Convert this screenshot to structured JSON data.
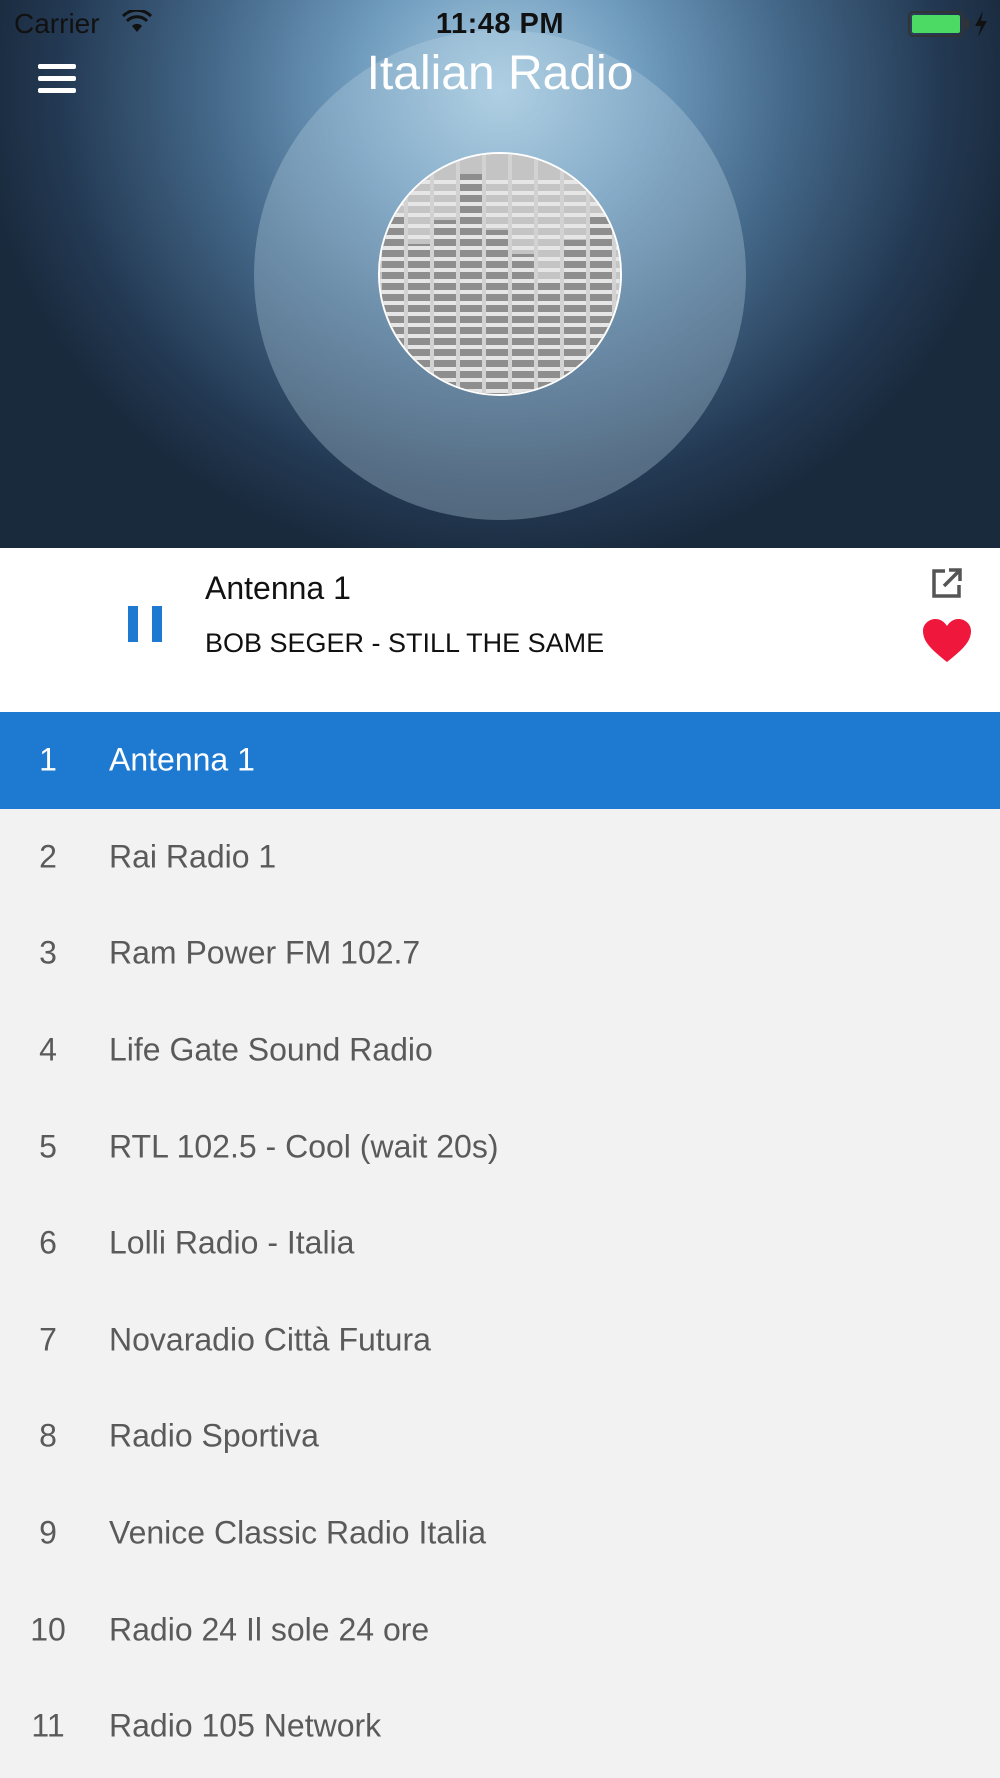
{
  "status_bar": {
    "carrier": "Carrier",
    "time": "11:48 PM",
    "icons": [
      "wifi-icon",
      "battery-icon",
      "charging-bolt-icon"
    ]
  },
  "header": {
    "title": "Italian Radio",
    "menu_icon": "hamburger-menu-icon"
  },
  "now_playing": {
    "station": "Antenna 1",
    "track": "BOB SEGER - STILL THE SAME",
    "state": "playing",
    "icons": [
      "pause-icon",
      "external-link-icon",
      "heart-icon"
    ]
  },
  "colors": {
    "accent": "#1e7ad1",
    "favorite": "#f0173d",
    "list_background": "#f2f2f2"
  },
  "stations": [
    {
      "num": "1",
      "name": "Antenna 1",
      "active": true
    },
    {
      "num": "2",
      "name": "Rai Radio 1"
    },
    {
      "num": "3",
      "name": "Ram Power FM 102.7"
    },
    {
      "num": "4",
      "name": "Life Gate Sound Radio"
    },
    {
      "num": "5",
      "name": "RTL 102.5 - Cool (wait 20s)"
    },
    {
      "num": "6",
      "name": "Lolli Radio - Italia"
    },
    {
      "num": "7",
      "name": "Novaradio Città Futura"
    },
    {
      "num": "8",
      "name": "Radio Sportiva"
    },
    {
      "num": "9",
      "name": "Venice Classic Radio Italia"
    },
    {
      "num": "10",
      "name": "Radio 24 Il sole 24 ore"
    },
    {
      "num": "11",
      "name": "Radio 105 Network"
    }
  ]
}
